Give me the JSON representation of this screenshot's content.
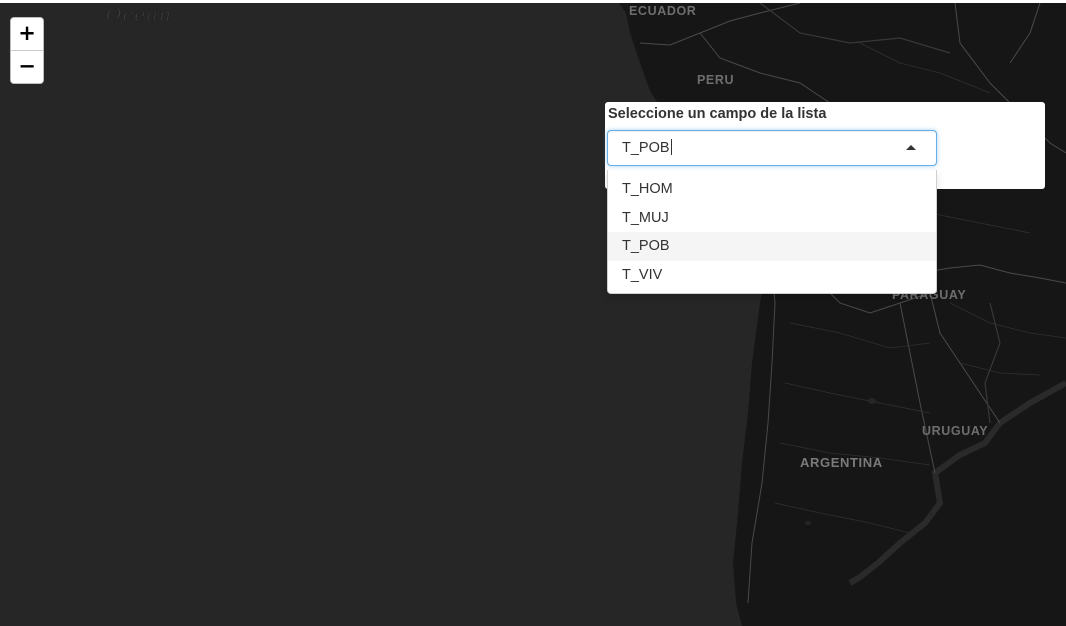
{
  "map": {
    "labels": {
      "ocean": "Ocean",
      "ecuador": "ECUADOR",
      "peru": "PERU",
      "paraguay": "PARAGUAY",
      "uruguay": "URUGUAY",
      "argentina": "ARGENTINA"
    },
    "colors": {
      "ocean": "#262626",
      "land": "#161616",
      "borders": "#4a4a4a"
    }
  },
  "zoom": {
    "in_label": "+",
    "out_label": "−"
  },
  "field_selector": {
    "label": "Seleccione un campo de la lista",
    "input_value": "T_POB",
    "options": [
      "T_HOM",
      "T_MUJ",
      "T_POB",
      "T_VIV"
    ],
    "highlighted_option": "T_POB",
    "focus_color": "#66afe9"
  }
}
